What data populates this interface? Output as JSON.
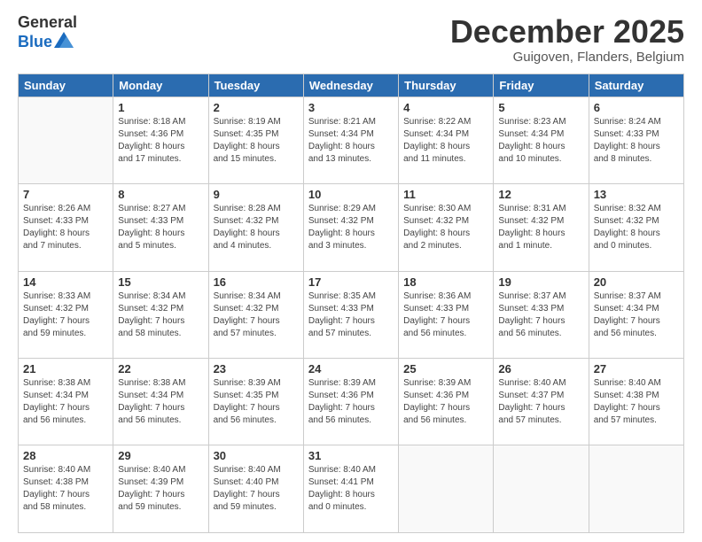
{
  "logo": {
    "general": "General",
    "blue": "Blue"
  },
  "header": {
    "month": "December 2025",
    "location": "Guigoven, Flanders, Belgium"
  },
  "days_of_week": [
    "Sunday",
    "Monday",
    "Tuesday",
    "Wednesday",
    "Thursday",
    "Friday",
    "Saturday"
  ],
  "weeks": [
    [
      {
        "day": "",
        "info": ""
      },
      {
        "day": "1",
        "info": "Sunrise: 8:18 AM\nSunset: 4:36 PM\nDaylight: 8 hours\nand 17 minutes."
      },
      {
        "day": "2",
        "info": "Sunrise: 8:19 AM\nSunset: 4:35 PM\nDaylight: 8 hours\nand 15 minutes."
      },
      {
        "day": "3",
        "info": "Sunrise: 8:21 AM\nSunset: 4:34 PM\nDaylight: 8 hours\nand 13 minutes."
      },
      {
        "day": "4",
        "info": "Sunrise: 8:22 AM\nSunset: 4:34 PM\nDaylight: 8 hours\nand 11 minutes."
      },
      {
        "day": "5",
        "info": "Sunrise: 8:23 AM\nSunset: 4:34 PM\nDaylight: 8 hours\nand 10 minutes."
      },
      {
        "day": "6",
        "info": "Sunrise: 8:24 AM\nSunset: 4:33 PM\nDaylight: 8 hours\nand 8 minutes."
      }
    ],
    [
      {
        "day": "7",
        "info": "Sunrise: 8:26 AM\nSunset: 4:33 PM\nDaylight: 8 hours\nand 7 minutes."
      },
      {
        "day": "8",
        "info": "Sunrise: 8:27 AM\nSunset: 4:33 PM\nDaylight: 8 hours\nand 5 minutes."
      },
      {
        "day": "9",
        "info": "Sunrise: 8:28 AM\nSunset: 4:32 PM\nDaylight: 8 hours\nand 4 minutes."
      },
      {
        "day": "10",
        "info": "Sunrise: 8:29 AM\nSunset: 4:32 PM\nDaylight: 8 hours\nand 3 minutes."
      },
      {
        "day": "11",
        "info": "Sunrise: 8:30 AM\nSunset: 4:32 PM\nDaylight: 8 hours\nand 2 minutes."
      },
      {
        "day": "12",
        "info": "Sunrise: 8:31 AM\nSunset: 4:32 PM\nDaylight: 8 hours\nand 1 minute."
      },
      {
        "day": "13",
        "info": "Sunrise: 8:32 AM\nSunset: 4:32 PM\nDaylight: 8 hours\nand 0 minutes."
      }
    ],
    [
      {
        "day": "14",
        "info": "Sunrise: 8:33 AM\nSunset: 4:32 PM\nDaylight: 7 hours\nand 59 minutes."
      },
      {
        "day": "15",
        "info": "Sunrise: 8:34 AM\nSunset: 4:32 PM\nDaylight: 7 hours\nand 58 minutes."
      },
      {
        "day": "16",
        "info": "Sunrise: 8:34 AM\nSunset: 4:32 PM\nDaylight: 7 hours\nand 57 minutes."
      },
      {
        "day": "17",
        "info": "Sunrise: 8:35 AM\nSunset: 4:33 PM\nDaylight: 7 hours\nand 57 minutes."
      },
      {
        "day": "18",
        "info": "Sunrise: 8:36 AM\nSunset: 4:33 PM\nDaylight: 7 hours\nand 56 minutes."
      },
      {
        "day": "19",
        "info": "Sunrise: 8:37 AM\nSunset: 4:33 PM\nDaylight: 7 hours\nand 56 minutes."
      },
      {
        "day": "20",
        "info": "Sunrise: 8:37 AM\nSunset: 4:34 PM\nDaylight: 7 hours\nand 56 minutes."
      }
    ],
    [
      {
        "day": "21",
        "info": "Sunrise: 8:38 AM\nSunset: 4:34 PM\nDaylight: 7 hours\nand 56 minutes."
      },
      {
        "day": "22",
        "info": "Sunrise: 8:38 AM\nSunset: 4:34 PM\nDaylight: 7 hours\nand 56 minutes."
      },
      {
        "day": "23",
        "info": "Sunrise: 8:39 AM\nSunset: 4:35 PM\nDaylight: 7 hours\nand 56 minutes."
      },
      {
        "day": "24",
        "info": "Sunrise: 8:39 AM\nSunset: 4:36 PM\nDaylight: 7 hours\nand 56 minutes."
      },
      {
        "day": "25",
        "info": "Sunrise: 8:39 AM\nSunset: 4:36 PM\nDaylight: 7 hours\nand 56 minutes."
      },
      {
        "day": "26",
        "info": "Sunrise: 8:40 AM\nSunset: 4:37 PM\nDaylight: 7 hours\nand 57 minutes."
      },
      {
        "day": "27",
        "info": "Sunrise: 8:40 AM\nSunset: 4:38 PM\nDaylight: 7 hours\nand 57 minutes."
      }
    ],
    [
      {
        "day": "28",
        "info": "Sunrise: 8:40 AM\nSunset: 4:38 PM\nDaylight: 7 hours\nand 58 minutes."
      },
      {
        "day": "29",
        "info": "Sunrise: 8:40 AM\nSunset: 4:39 PM\nDaylight: 7 hours\nand 59 minutes."
      },
      {
        "day": "30",
        "info": "Sunrise: 8:40 AM\nSunset: 4:40 PM\nDaylight: 7 hours\nand 59 minutes."
      },
      {
        "day": "31",
        "info": "Sunrise: 8:40 AM\nSunset: 4:41 PM\nDaylight: 8 hours\nand 0 minutes."
      },
      {
        "day": "",
        "info": ""
      },
      {
        "day": "",
        "info": ""
      },
      {
        "day": "",
        "info": ""
      }
    ]
  ]
}
